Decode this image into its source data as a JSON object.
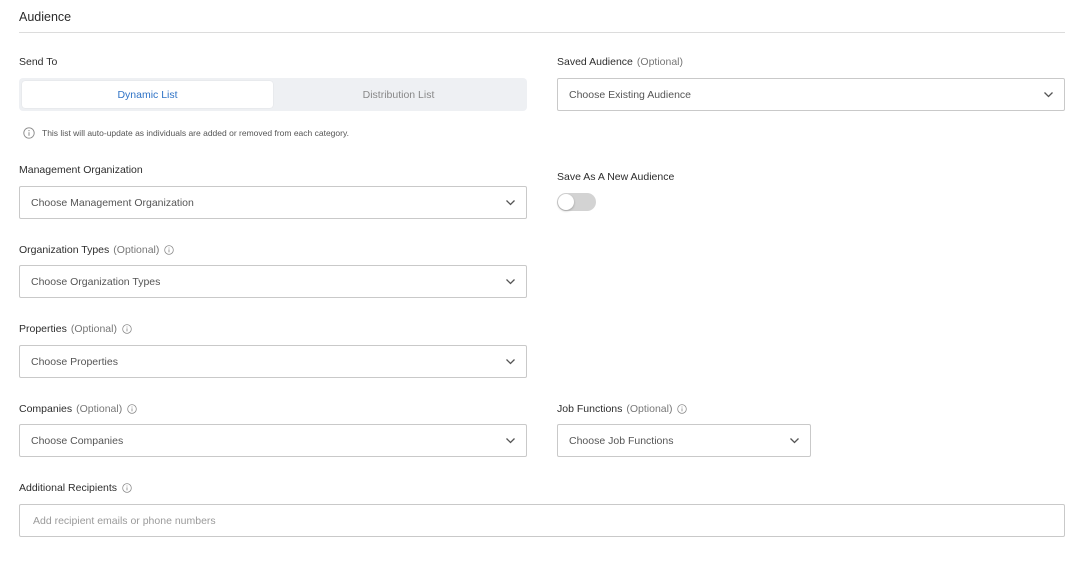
{
  "section": {
    "title": "Audience"
  },
  "send_to": {
    "label": "Send To",
    "options": [
      "Dynamic List",
      "Distribution List"
    ],
    "selected_index": 0,
    "hint": "This list will auto-update as individuals are added or removed from each category."
  },
  "saved_audience": {
    "label": "Saved Audience",
    "optional": "(Optional)",
    "placeholder": "Choose Existing Audience"
  },
  "save_new_audience": {
    "label": "Save As A New Audience",
    "enabled": false
  },
  "management_org": {
    "label": "Management Organization",
    "placeholder": "Choose Management Organization"
  },
  "org_types": {
    "label": "Organization Types",
    "optional": "(Optional)",
    "placeholder": "Choose Organization Types"
  },
  "properties": {
    "label": "Properties",
    "optional": "(Optional)",
    "placeholder": "Choose Properties"
  },
  "companies": {
    "label": "Companies",
    "optional": "(Optional)",
    "placeholder": "Choose Companies"
  },
  "job_functions": {
    "label": "Job Functions",
    "optional": "(Optional)",
    "placeholder": "Choose Job Functions"
  },
  "additional_recipients": {
    "label": "Additional Recipients",
    "placeholder": "Add recipient emails or phone numbers"
  },
  "colors": {
    "accent": "#2f73c6",
    "border": "#c9c9c9",
    "segment_bg": "#eef0f3",
    "toggle_off": "#d3d3d3"
  }
}
